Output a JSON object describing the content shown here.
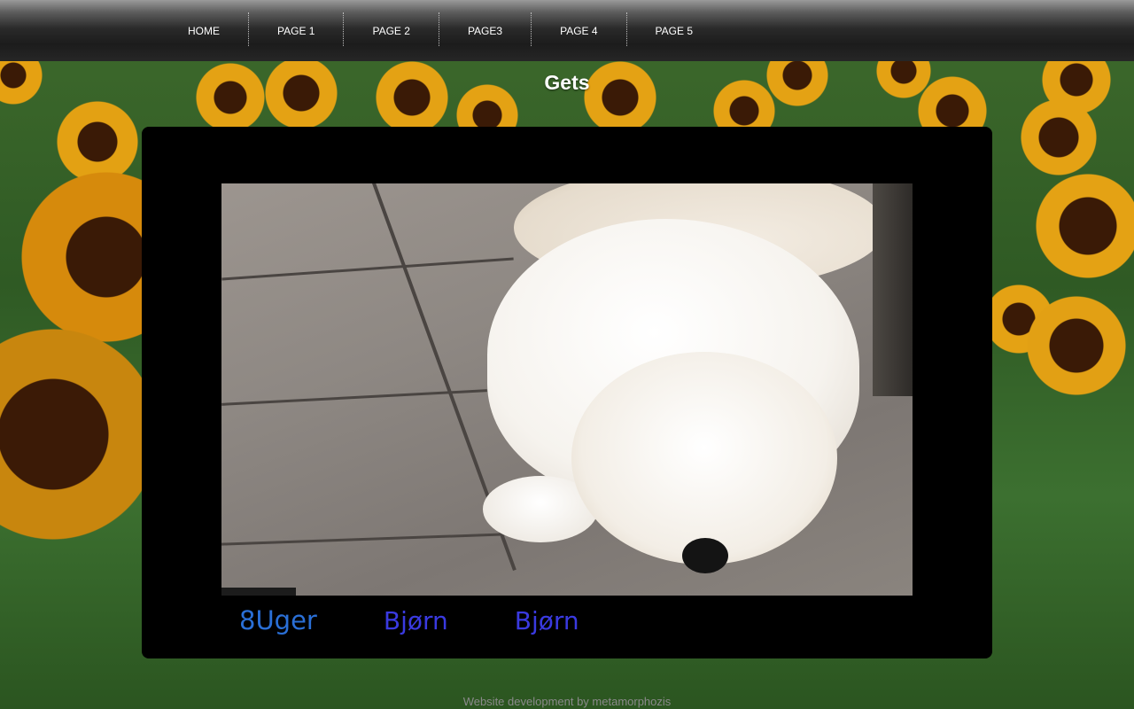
{
  "nav": {
    "items": [
      {
        "label": "HOME"
      },
      {
        "label": "PAGE 1"
      },
      {
        "label": "PAGE 2"
      },
      {
        "label": "PAGE3"
      },
      {
        "label": "PAGE 4"
      },
      {
        "label": "PAGE 5"
      }
    ]
  },
  "page": {
    "title": "Gets"
  },
  "gallery": {
    "thumbnails": [
      {
        "label": "8Uger"
      },
      {
        "label": "Bjørn"
      },
      {
        "label": "Bjørn"
      }
    ]
  },
  "footer": {
    "text": "Website development by metamorphozis"
  },
  "colors": {
    "content_background": "#000000",
    "nav_text": "#ffffff",
    "thumb_link_1": "#2a6fd6",
    "thumb_link": "#3a3ae0",
    "footer_text": "#8a8a8a"
  }
}
